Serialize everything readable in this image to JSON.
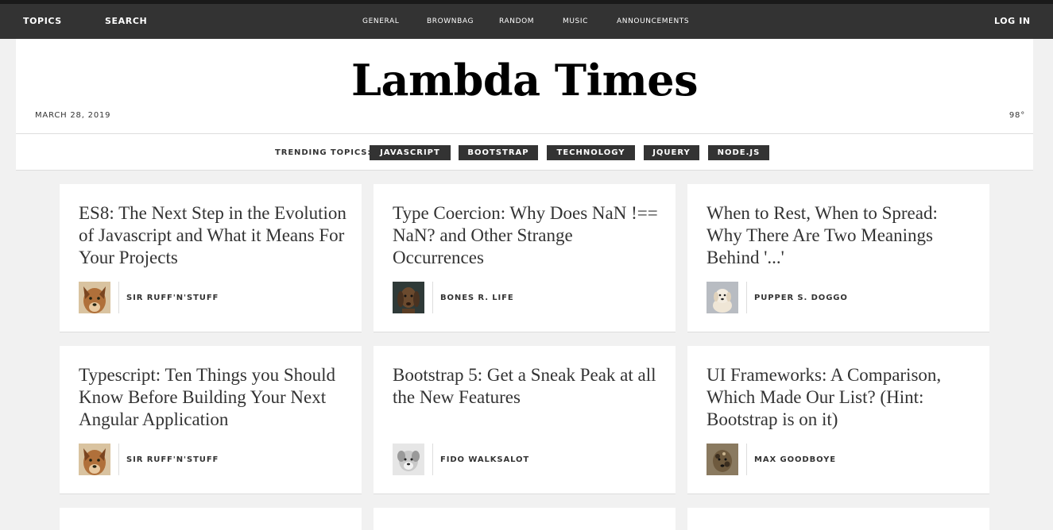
{
  "nav": {
    "left": [
      "TOPICS",
      "SEARCH"
    ],
    "center": [
      "GENERAL",
      "BROWNBAG",
      "RANDOM",
      "MUSIC",
      "ANNOUNCEMENTS"
    ],
    "right": "LOG IN"
  },
  "header": {
    "title": "Lambda Times",
    "date": "MARCH 28, 2019",
    "temperature": "98°"
  },
  "trending": {
    "label": "TRENDING TOPICS:",
    "tags": [
      "JAVASCRIPT",
      "BOOTSTRAP",
      "TECHNOLOGY",
      "JQUERY",
      "NODE.JS"
    ]
  },
  "cards": [
    {
      "headline": "ES8: The Next Step in the Evolution of Javascript and What it Means For Your Projects",
      "author": "SIR RUFF'N'STUFF",
      "avatar": "dog-tan-photo"
    },
    {
      "headline": "Type Coercion: Why Does NaN !== NaN? and Other Strange Occurrences",
      "author": "BONES R. LIFE",
      "avatar": "dog-dark-photo"
    },
    {
      "headline": "When to Rest, When to Spread: Why There Are Two Meanings Behind '...'",
      "author": "PUPPER S. DOGGO",
      "avatar": "puppy-white-photo"
    },
    {
      "headline": "Typescript: Ten Things you Should Know Before Building Your Next Angular Application",
      "author": "SIR RUFF'N'STUFF",
      "avatar": "dog-tan-photo"
    },
    {
      "headline": "Bootstrap 5: Get a Sneak Peak at all the New Features",
      "author": "FIDO WALKSALOT",
      "avatar": "dog-gray-photo"
    },
    {
      "headline": "UI Frameworks: A Comparison, Which Made Our List? (Hint: Bootstrap is on it)",
      "author": "MAX GOODBOYE",
      "avatar": "dog-spotted-photo"
    }
  ],
  "colors": {
    "nav_bg": "#333333",
    "page_bg": "#f1f1f1",
    "tag_bg": "#333333",
    "text": "#333333"
  }
}
